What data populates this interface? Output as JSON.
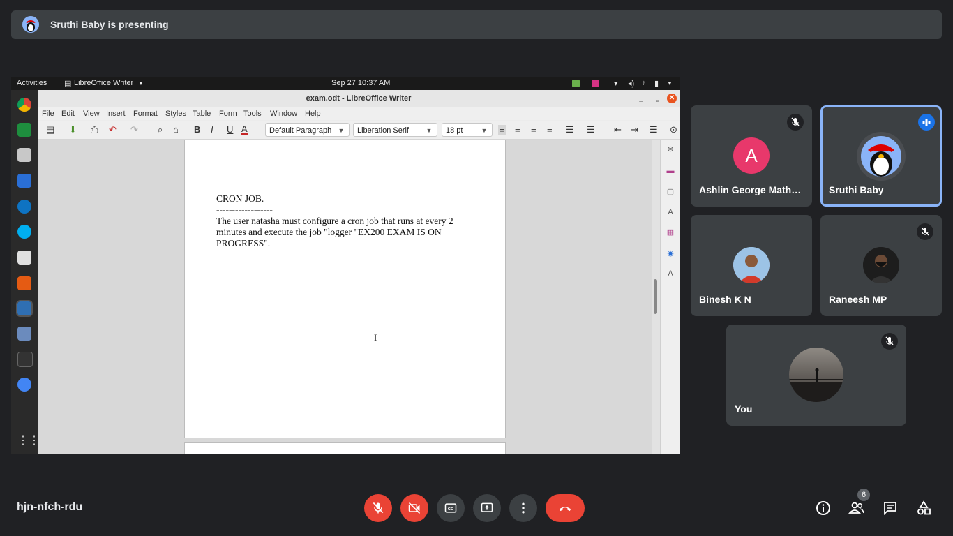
{
  "banner": {
    "text": "Sruthi Baby is presenting",
    "avatar": "penguin-redhat-avatar"
  },
  "shared_screen": {
    "topbar": {
      "activities": "Activities",
      "app_menu": "LibreOffice Writer",
      "datetime": "Sep 27  10:37 AM"
    },
    "window": {
      "title": "exam.odt - LibreOffice Writer",
      "menu": [
        "File",
        "Edit",
        "View",
        "Insert",
        "Format",
        "Styles",
        "Table",
        "Form",
        "Tools",
        "Window",
        "Help"
      ],
      "toolbar": {
        "paragraph_style": "Default Paragraph",
        "font_name": "Liberation Serif",
        "font_size": "18 pt"
      },
      "document": {
        "heading": "CRON JOB.",
        "rule": "------------------",
        "body": "The user natasha must configure a cron job that runs at every 2 minutes and execute the job \"logger \"EX200 EXAM IS ON PROGRESS\"."
      }
    }
  },
  "participants": [
    {
      "name": "Ashlin George Mathew",
      "name_display": "Ashlin George Math…",
      "initial": "A",
      "avatar_color": "#e8386b",
      "muted": true
    },
    {
      "name": "Sruthi Baby",
      "speaking": true,
      "highlight_color": "#8ab4f8"
    },
    {
      "name": "Binesh K N",
      "muted": false
    },
    {
      "name": "Raneesh MP",
      "muted": true
    },
    {
      "name": "You",
      "muted": true
    }
  ],
  "bottom_bar": {
    "meeting_code": "hjn-nfch-rdu",
    "controls": [
      "mic-off",
      "camera-off",
      "captions",
      "present",
      "more-options",
      "leave-call"
    ],
    "people_count": "6"
  },
  "colors": {
    "background": "#202124",
    "tile": "#3c4043",
    "danger": "#ea4335",
    "accent": "#8ab4f8"
  }
}
